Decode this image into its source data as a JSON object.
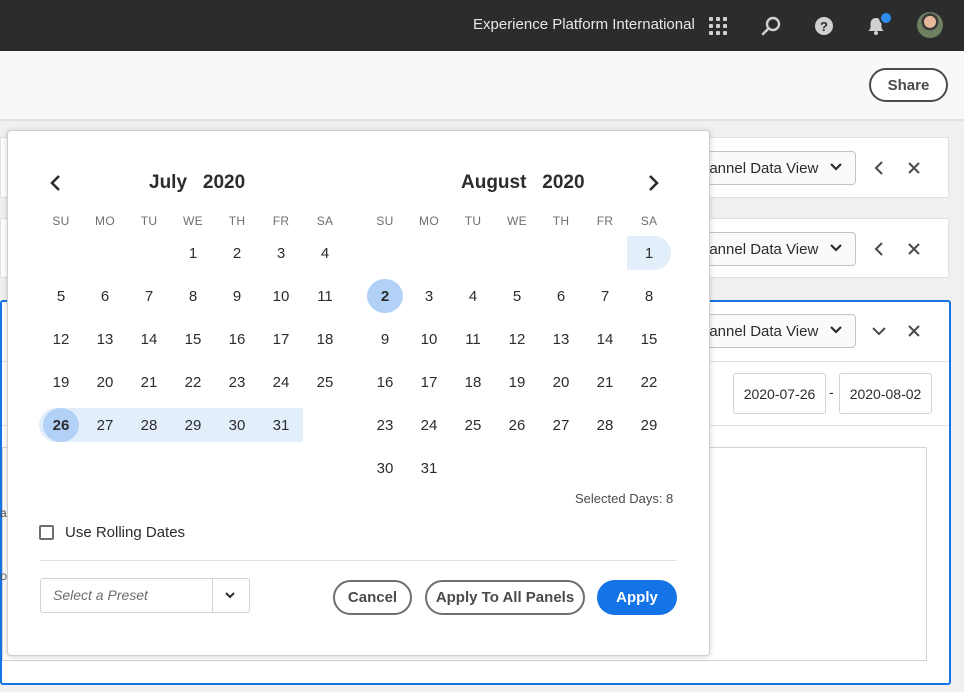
{
  "topbar": {
    "org_name": "Experience Platform International",
    "icons": [
      "apps-icon",
      "search-icon",
      "help-icon",
      "bell-icon",
      "avatar"
    ],
    "notification_color": "#2f8ef2"
  },
  "header": {
    "share_label": "Share"
  },
  "panels": [
    {
      "data_view_label": "hannel Data View",
      "collapse_icon": "chevron-left-icon"
    },
    {
      "data_view_label": "hannel Data View",
      "collapse_icon": "chevron-left-icon"
    },
    {
      "data_view_label": "hannel Data View",
      "collapse_icon": "chevron-down-icon",
      "start_date": "2020-07-26",
      "end_date": "2020-08-02",
      "date_separator": "-"
    }
  ],
  "left_fragments": [
    "a",
    "OF"
  ],
  "calendar": {
    "left_month": "July",
    "left_year": "2020",
    "right_month": "August",
    "right_year": "2020",
    "weekdays": [
      "SU",
      "MO",
      "TU",
      "WE",
      "TH",
      "FR",
      "SA"
    ],
    "july_days": [
      "1",
      "2",
      "3",
      "4",
      "5",
      "6",
      "7",
      "8",
      "9",
      "10",
      "11",
      "12",
      "13",
      "14",
      "15",
      "16",
      "17",
      "18",
      "19",
      "20",
      "21",
      "22",
      "23",
      "24",
      "25",
      "26",
      "27",
      "28",
      "29",
      "30",
      "31"
    ],
    "august_days": [
      "1",
      "2",
      "3",
      "4",
      "5",
      "6",
      "7",
      "8",
      "9",
      "10",
      "11",
      "12",
      "13",
      "14",
      "15",
      "16",
      "17",
      "18",
      "19",
      "20",
      "21",
      "22",
      "23",
      "24",
      "25",
      "26",
      "27",
      "28",
      "29",
      "30",
      "31"
    ],
    "range_start": "2020-07-26",
    "range_end": "2020-08-01",
    "highlighted_day": "2020-08-02",
    "selected_days_text": "Selected Days: 8",
    "accent_color": "#1473e6",
    "range_color": "#e3eefb",
    "selected_color": "#b2d1f6"
  },
  "options": {
    "rolling_label": "Use Rolling Dates",
    "rolling_checked": false
  },
  "preset": {
    "placeholder": "Select a Preset"
  },
  "buttons": {
    "cancel": "Cancel",
    "apply_all": "Apply To All Panels",
    "apply": "Apply"
  }
}
